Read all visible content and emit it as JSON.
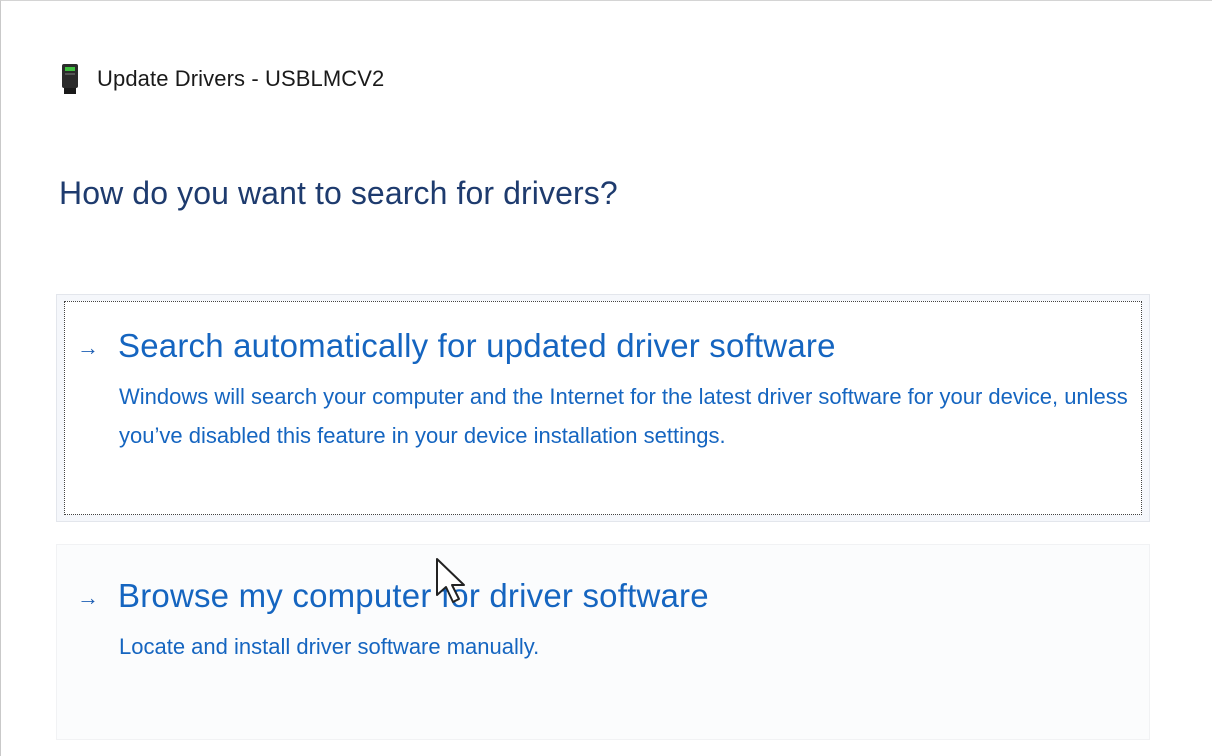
{
  "window": {
    "title": "Update Drivers - USBLMCV2",
    "icon": "usb-device-icon"
  },
  "heading": "How do you want to search for drivers?",
  "options": [
    {
      "arrow": "→",
      "title": "Search automatically for updated driver software",
      "description": "Windows will search your computer and the Internet for the latest driver software for your device, unless you’ve disabled this feature in your device installation settings.",
      "focused": true
    },
    {
      "arrow": "→",
      "title": "Browse my computer for driver software",
      "description": "Locate and install driver software manually.",
      "focused": false
    }
  ],
  "colors": {
    "heading": "#1e3b6e",
    "link": "#1565c0"
  }
}
